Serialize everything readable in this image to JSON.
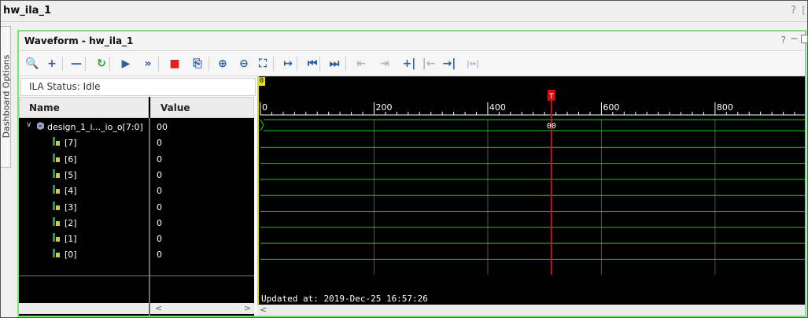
{
  "window": {
    "title": "hw_ila_1",
    "help": "?",
    "extra": "["
  },
  "side_tab": {
    "label": "Dashboard Options"
  },
  "panel": {
    "title": "Waveform - hw_ila_1",
    "help": "?",
    "minimize": "−"
  },
  "toolbar": {
    "items": [
      {
        "icon": "zoom-search-icon",
        "glyph": "🔍"
      },
      {
        "icon": "add-icon",
        "glyph": "+"
      },
      {
        "icon": "remove-icon",
        "glyph": "—"
      },
      {
        "icon": "run-trigger-immediate-icon",
        "glyph": "↻"
      },
      {
        "icon": "run-trigger-icon",
        "glyph": "▶"
      },
      {
        "icon": "run-trigger-continuous-icon",
        "glyph": "»"
      },
      {
        "icon": "stop-icon",
        "glyph": "■"
      },
      {
        "icon": "export-icon",
        "glyph": "⎘"
      },
      {
        "icon": "zoom-in-icon",
        "glyph": "⊕"
      },
      {
        "icon": "zoom-out-icon",
        "glyph": "⊖"
      },
      {
        "icon": "zoom-fit-icon",
        "glyph": "⛶"
      },
      {
        "icon": "go-to-cursor-icon",
        "glyph": "↦"
      },
      {
        "icon": "go-to-start-icon",
        "glyph": "⏮"
      },
      {
        "icon": "go-to-end-icon",
        "glyph": "⏭"
      },
      {
        "icon": "previous-transition-icon",
        "glyph": "⇤"
      },
      {
        "icon": "next-transition-icon",
        "glyph": "⇥"
      },
      {
        "icon": "add-marker-icon",
        "glyph": "+|"
      },
      {
        "icon": "previous-marker-icon",
        "glyph": "|←"
      },
      {
        "icon": "next-marker-icon",
        "glyph": "→|"
      },
      {
        "icon": "swap-cursors-icon",
        "glyph": "|↔|"
      }
    ],
    "colors": {
      "primary": "#2b5fa8",
      "stop": "#e02020",
      "disabled": "#a8b4c8"
    }
  },
  "ila_status": "ILA Status: Idle",
  "columns": {
    "name": "Name",
    "value": "Value"
  },
  "signals": [
    {
      "name": "design_1_i..._io_o[7:0]",
      "value": "00",
      "icon": "bus-icon",
      "expanded": true
    },
    {
      "name": "[7]",
      "value": "0",
      "icon": "bit-signal-icon"
    },
    {
      "name": "[6]",
      "value": "0",
      "icon": "bit-signal-icon"
    },
    {
      "name": "[5]",
      "value": "0",
      "icon": "bit-signal-icon"
    },
    {
      "name": "[4]",
      "value": "0",
      "icon": "bit-signal-icon"
    },
    {
      "name": "[3]",
      "value": "0",
      "icon": "bit-signal-icon"
    },
    {
      "name": "[2]",
      "value": "0",
      "icon": "bit-signal-icon"
    },
    {
      "name": "[1]",
      "value": "0",
      "icon": "bit-signal-icon"
    },
    {
      "name": "[0]",
      "value": "0",
      "icon": "bit-signal-icon"
    }
  ],
  "waveform": {
    "start_marker": "0",
    "trigger_marker": "T",
    "trigger_sample": 512,
    "sample_range": [
      0,
      958
    ],
    "ruler_labels": [
      "0",
      "200",
      "400",
      "600",
      "800"
    ],
    "bus_value": "00",
    "updated": "Updated at: 2019-Dec-25 16:57:26",
    "colors": {
      "signal": "#22c322",
      "trigger": "#cc1111",
      "grid": "#555555",
      "marker": "#e0e020"
    }
  },
  "scroll": {
    "left": "<",
    "right": ">"
  }
}
